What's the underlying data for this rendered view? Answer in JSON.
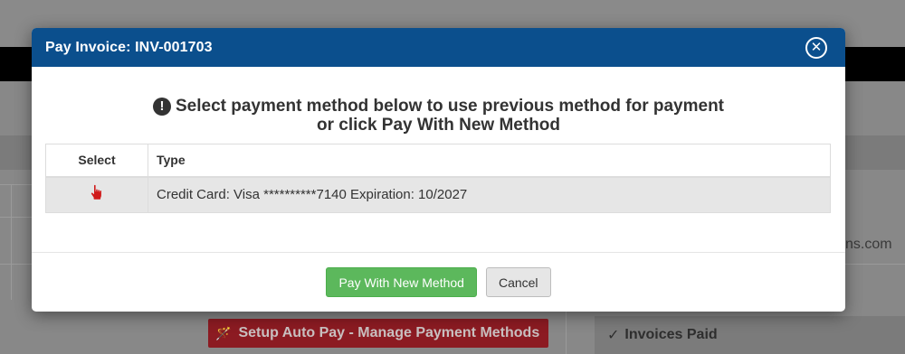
{
  "background": {
    "email_fragment": "ns.com",
    "autopay_button_label": "Setup Auto Pay - Manage Payment Methods",
    "invoices_paid_label": "Invoices Paid"
  },
  "modal": {
    "title": "Pay Invoice: INV-001703",
    "prompt_line1": "Select payment method below to use previous method for payment",
    "prompt_line2": "or click Pay With New Method",
    "table": {
      "headers": [
        "Select",
        "Type"
      ],
      "rows": [
        {
          "type": "Credit Card: Visa **********7140 Expiration: 10/2027"
        }
      ]
    },
    "buttons": {
      "pay_new": "Pay With New Method",
      "cancel": "Cancel"
    }
  },
  "colors": {
    "header_blue": "#0b4f8d",
    "success_green": "#5cb85c",
    "select_icon_red": "#d01b1b",
    "autopay_red": "#8c1b22"
  },
  "icons": {
    "close": "close-circle-icon",
    "alert": "exclamation-circle-icon",
    "select": "pointing-hand-icon",
    "autopay": "magic-wand-icon",
    "invoices_paid": "checkmark-icon"
  }
}
